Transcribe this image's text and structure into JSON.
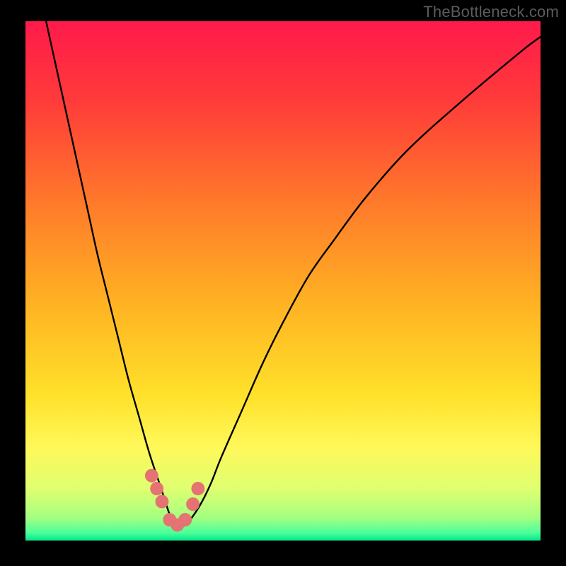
{
  "watermark": {
    "text": "TheBottleneck.com"
  },
  "colors": {
    "black": "#000000",
    "curve": "#000000",
    "dot": "#e57373",
    "gradient_stops": [
      {
        "offset": 0.0,
        "color": "#ff1a4b"
      },
      {
        "offset": 0.15,
        "color": "#ff3a3a"
      },
      {
        "offset": 0.35,
        "color": "#ff7a2a"
      },
      {
        "offset": 0.55,
        "color": "#ffb423"
      },
      {
        "offset": 0.72,
        "color": "#ffe12a"
      },
      {
        "offset": 0.82,
        "color": "#fff85a"
      },
      {
        "offset": 0.9,
        "color": "#dfff70"
      },
      {
        "offset": 0.955,
        "color": "#a6ff80"
      },
      {
        "offset": 0.985,
        "color": "#4dff9c"
      },
      {
        "offset": 1.0,
        "color": "#00e888"
      }
    ]
  },
  "chart_data": {
    "type": "line",
    "title": "",
    "xlabel": "",
    "ylabel": "",
    "xlim": [
      0,
      100
    ],
    "ylim": [
      0,
      100
    ],
    "grid": false,
    "legend": false,
    "series": [
      {
        "name": "bottleneck-curve",
        "x": [
          4,
          6,
          8,
          10,
          12,
          14,
          16,
          18,
          20,
          22,
          24,
          26,
          27,
          28,
          29,
          30,
          31,
          32,
          34,
          36,
          38,
          42,
          46,
          50,
          55,
          60,
          66,
          74,
          84,
          96,
          100
        ],
        "y": [
          100,
          91,
          82,
          73,
          64,
          55,
          47,
          39,
          31,
          24,
          17,
          11,
          8,
          5,
          3,
          2.5,
          3,
          4,
          7,
          11,
          16,
          25,
          34,
          42,
          51,
          58,
          66,
          75,
          84,
          94,
          97
        ]
      }
    ],
    "marker_points": {
      "name": "highlight-dots",
      "x": [
        24.5,
        25.5,
        26.5,
        28.0,
        29.5,
        31.0,
        32.5,
        33.5
      ],
      "y": [
        12.5,
        10.0,
        7.5,
        4.0,
        3.0,
        4.0,
        7.0,
        10.0
      ]
    }
  }
}
